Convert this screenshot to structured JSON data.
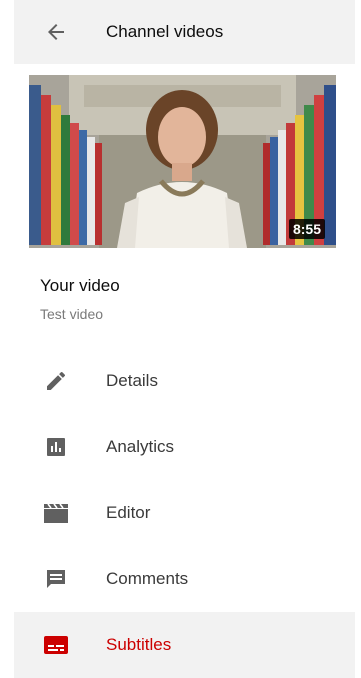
{
  "header": {
    "title": "Channel videos"
  },
  "video": {
    "duration": "8:55",
    "title": "Your video",
    "subtitle": "Test video"
  },
  "menu": {
    "items": [
      {
        "label": "Details",
        "icon": "pencil-icon"
      },
      {
        "label": "Analytics",
        "icon": "analytics-icon"
      },
      {
        "label": "Editor",
        "icon": "clapperboard-icon"
      },
      {
        "label": "Comments",
        "icon": "comment-icon"
      },
      {
        "label": "Subtitles",
        "icon": "subtitles-icon",
        "active": true
      }
    ]
  },
  "colors": {
    "accent": "#cc0000",
    "icon": "#606060",
    "header_bg": "#f2f2f2"
  }
}
